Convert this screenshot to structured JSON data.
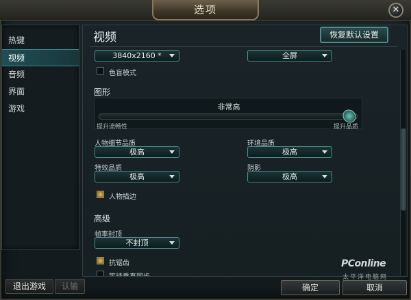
{
  "window": {
    "title": "选项"
  },
  "sidebar": {
    "items": [
      {
        "label": "热键"
      },
      {
        "label": "视频"
      },
      {
        "label": "音频"
      },
      {
        "label": "界面"
      },
      {
        "label": "游戏"
      }
    ],
    "active_index": 1
  },
  "main": {
    "title": "视频",
    "restore_label": "恢复默认设置",
    "resolution": "3840x2160 *",
    "window_mode": "全屏",
    "colorblind_label": "色盲模式",
    "colorblind_checked": false,
    "graphics": {
      "section_title": "图形",
      "slider_value": "非常高",
      "slider_min_label": "提升流畅性",
      "slider_max_label": "提升品质",
      "slider_level": 1.0
    },
    "quality": {
      "character_label": "人物细节品质",
      "character_value": "极高",
      "environment_label": "环境品质",
      "environment_value": "极高",
      "effects_label": "特效品质",
      "effects_value": "极高",
      "shadows_label": "阴影",
      "shadows_value": "极高",
      "outline_label": "人物描边",
      "outline_checked": true
    },
    "advanced": {
      "section_title": "高级",
      "fps_cap_label": "帧率封顶",
      "fps_cap_value": "不封顶",
      "antialias_label": "抗锯齿",
      "antialias_checked": true,
      "vsync_label": "等待垂直同步",
      "vsync_checked": false
    }
  },
  "footer": {
    "exit_label": "退出游戏",
    "surrender_label": "认输",
    "confirm_label": "确定",
    "cancel_label": "取消"
  },
  "watermark": {
    "brand": "PConline",
    "sub": "太平洋电脑网"
  },
  "colors": {
    "accent": "#4a8c8e",
    "active_tab": "#1f4f56",
    "gold": "#8a7a5b"
  }
}
